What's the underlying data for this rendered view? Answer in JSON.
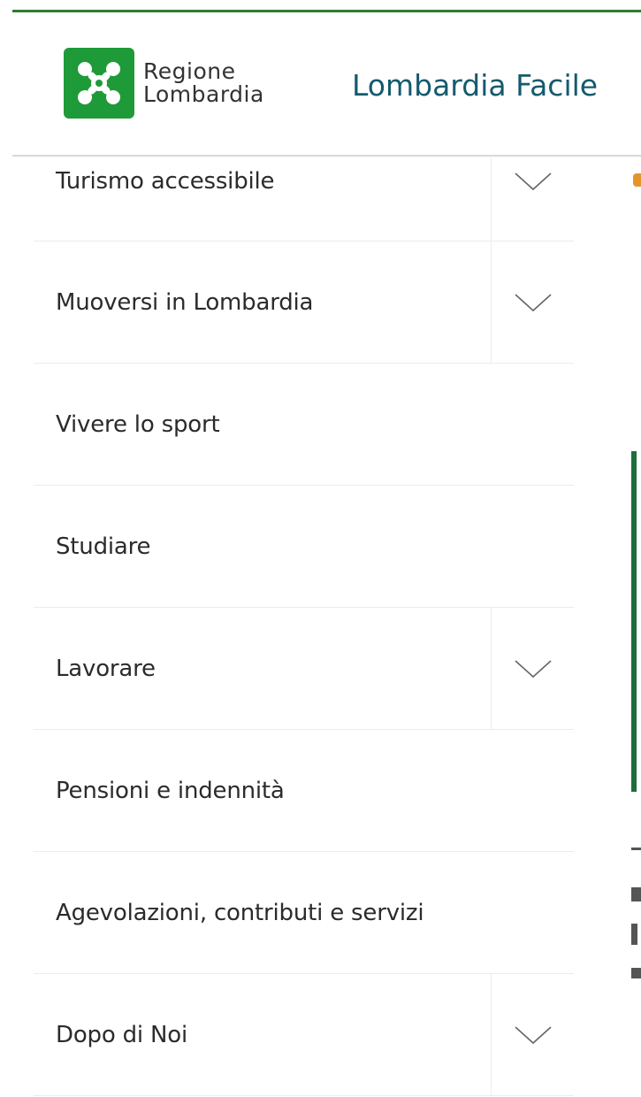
{
  "header": {
    "logo_line1": "Regione",
    "logo_line2": "Lombardia",
    "site_title": "Lombardia Facile"
  },
  "menu": {
    "items": [
      {
        "label": "Turismo accessibile",
        "has_submenu": true
      },
      {
        "label": "Muoversi in Lombardia",
        "has_submenu": true
      },
      {
        "label": "Vivere lo sport",
        "has_submenu": false
      },
      {
        "label": "Studiare",
        "has_submenu": false
      },
      {
        "label": "Lavorare",
        "has_submenu": true
      },
      {
        "label": "Pensioni e indennità",
        "has_submenu": false
      },
      {
        "label": "Agevolazioni, contributi e servizi",
        "has_submenu": false
      },
      {
        "label": "Dopo di Noi",
        "has_submenu": true
      }
    ],
    "toggle_icon": "chevron-down-icon"
  },
  "colors": {
    "brand_green": "#1f9a38",
    "accent_bar": "#2e7d32",
    "title_blue": "#155a6e"
  }
}
